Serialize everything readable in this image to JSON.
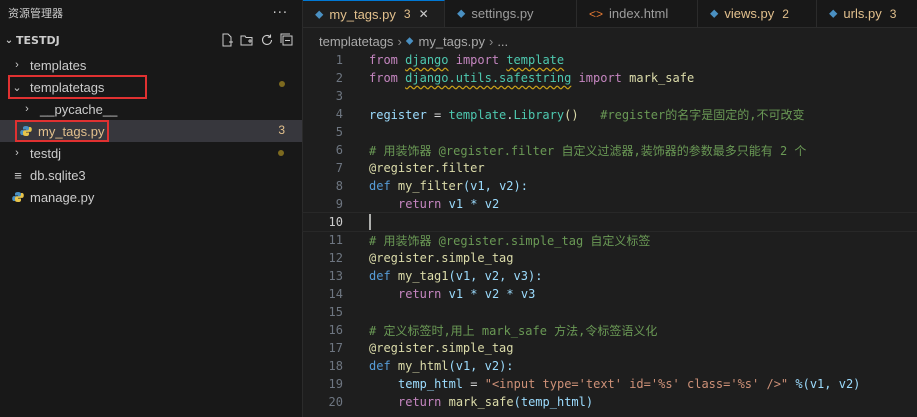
{
  "sidebar": {
    "title": "资源管理器",
    "more": "···",
    "project": "TESTDJ",
    "items": [
      {
        "label": "templates",
        "type": "folder",
        "expanded": false
      },
      {
        "label": "templatetags",
        "type": "folder",
        "expanded": true,
        "badge": "dot",
        "highlighted": true
      },
      {
        "label": "__pycache__",
        "type": "folder",
        "expanded": false
      },
      {
        "label": "my_tags.py",
        "type": "python",
        "count": "3",
        "selected": true,
        "highlighted": true
      },
      {
        "label": "testdj",
        "type": "folder",
        "expanded": false,
        "badge": "dot"
      },
      {
        "label": "db.sqlite3",
        "type": "database"
      },
      {
        "label": "manage.py",
        "type": "python"
      }
    ]
  },
  "tabs": [
    {
      "label": "my_tags.py",
      "count": "3",
      "active": true,
      "icon": "python-icon"
    },
    {
      "label": "settings.py",
      "icon": "python-icon"
    },
    {
      "label": "index.html",
      "icon": "html-icon"
    },
    {
      "label": "views.py",
      "count": "2",
      "icon": "python-icon"
    },
    {
      "label": "urls.py",
      "count": "3",
      "icon": "python-icon"
    }
  ],
  "breadcrumb": {
    "folder": "templatetags",
    "file": "my_tags.py",
    "more": "..."
  },
  "colors": {
    "accent": "#0078d4",
    "modified": "#e2c08d",
    "highlight_box": "#e03131"
  },
  "code": {
    "line_numbers": [
      "1",
      "2",
      "3",
      "4",
      "5",
      "6",
      "7",
      "8",
      "9",
      "10",
      "11",
      "12",
      "13",
      "14",
      "15",
      "16",
      "17",
      "18",
      "19",
      "20"
    ],
    "current_line": "10",
    "l1": {
      "kw": "from",
      "mod": "django",
      "kw2": "import",
      "mod2": "template"
    },
    "l2": {
      "kw": "from",
      "mod": "django.utils.safestring",
      "kw2": "import",
      "mod2": "mark_safe"
    },
    "l4": {
      "var": "register",
      "eq": " = ",
      "mod": "template",
      "dot": ".",
      "cls": "Library",
      "paren": "()",
      "cm": "#register的名字是固定的,不可改变"
    },
    "l6": {
      "cm": "# 用装饰器 @register.filter 自定义过滤器,装饰器的参数最多只能有 2 个"
    },
    "l7": {
      "dec": "@register",
      "rest": ".filter"
    },
    "l8": {
      "kw": "def",
      "fn": "my_filter",
      "args": "(v1, v2):"
    },
    "l9": {
      "kw": "return",
      "expr": "v1 * v2"
    },
    "l11": {
      "cm": "# 用装饰器 @register.simple_tag 自定义标签"
    },
    "l12": {
      "dec": "@register",
      "rest": ".simple_tag"
    },
    "l13": {
      "kw": "def",
      "fn": "my_tag1",
      "args": "(v1, v2, v3):"
    },
    "l14": {
      "kw": "return",
      "expr": "v1 * v2 * v3"
    },
    "l16": {
      "cm": "# 定义标签时,用上 mark_safe 方法,令标签语义化"
    },
    "l17": {
      "dec": "@register",
      "rest": ".simple_tag"
    },
    "l18": {
      "kw": "def",
      "fn": "my_html",
      "args": "(v1, v2):"
    },
    "l19": {
      "var": "temp_html",
      "eq": " = ",
      "str": "\"<input type='text' id='%s' class='%s' />\"",
      "rest": " %(v1, v2)"
    },
    "l20": {
      "kw": "return",
      "fn": "mark_safe",
      "args": "(temp_html)"
    }
  }
}
